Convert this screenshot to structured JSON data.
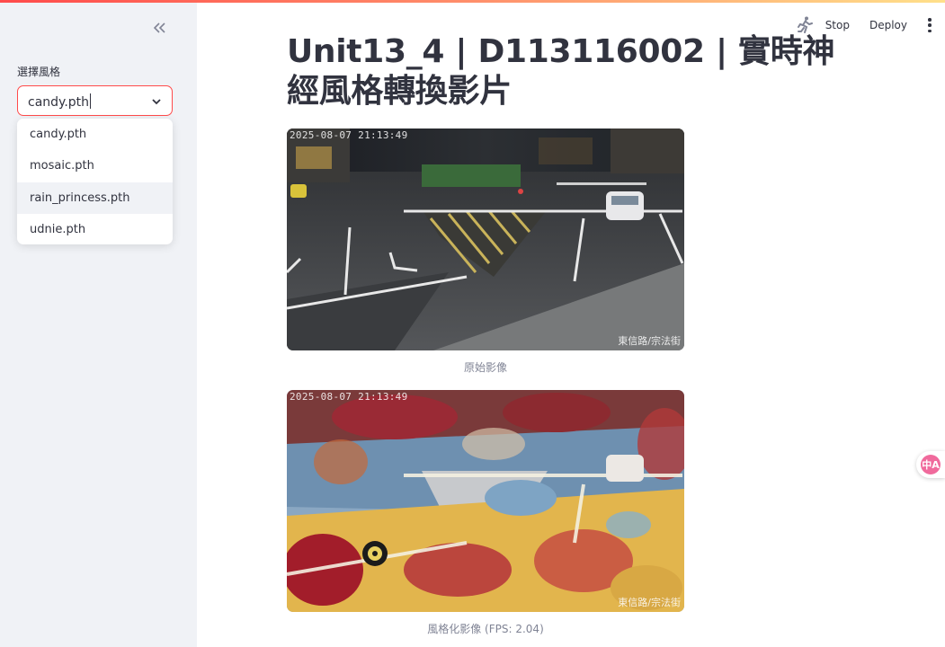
{
  "sidebar": {
    "select_label": "選擇風格",
    "selected_value": "candy.pth",
    "options": [
      "candy.pth",
      "mosaic.pth",
      "rain_princess.pth",
      "udnie.pth"
    ]
  },
  "header": {
    "stop_label": "Stop",
    "deploy_label": "Deploy"
  },
  "main": {
    "title": "Unit13_4 | D113116002 | 實時神經風格轉換影片",
    "original": {
      "timestamp": "2025-08-07 21:13:49",
      "location": "東信路/宗法街",
      "caption": "原始影像"
    },
    "styled": {
      "timestamp": "2025-08-07 21:13:49",
      "location": "東信路/宗法街",
      "caption": "風格化影像 (FPS: 2.04)"
    }
  },
  "translate_badge": "中A",
  "colors": {
    "accent": "#ff4b4b",
    "sidebar_bg": "#f0f2f6",
    "text": "#31333f"
  }
}
